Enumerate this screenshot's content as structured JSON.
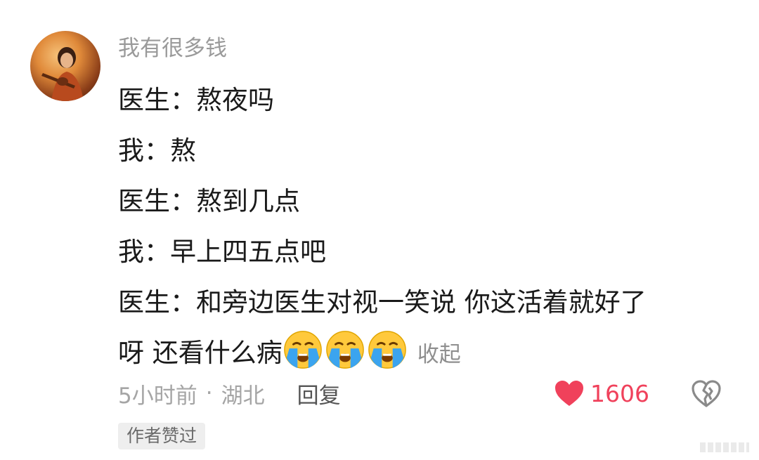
{
  "comment": {
    "username": "我有很多钱",
    "lines": [
      "医生：熬夜吗",
      "我：熬",
      "医生：熬到几点",
      "我：早上四五点吧",
      "医生：和旁边医生对视一笑说 你这活着就好了",
      "呀 还看什么病"
    ],
    "emoji_names": [
      "loudly-crying-face-icon",
      "loudly-crying-face-icon",
      "loudly-crying-face-icon"
    ],
    "collapse_label": "收起",
    "time": "5小时前",
    "separator": "·",
    "location": "湖北",
    "reply_label": "回复",
    "like_count": "1606",
    "author_badge": "作者赞过"
  },
  "colors": {
    "like": "#f0415b",
    "meta": "#a5a5a5",
    "username": "#9a9a9a"
  }
}
